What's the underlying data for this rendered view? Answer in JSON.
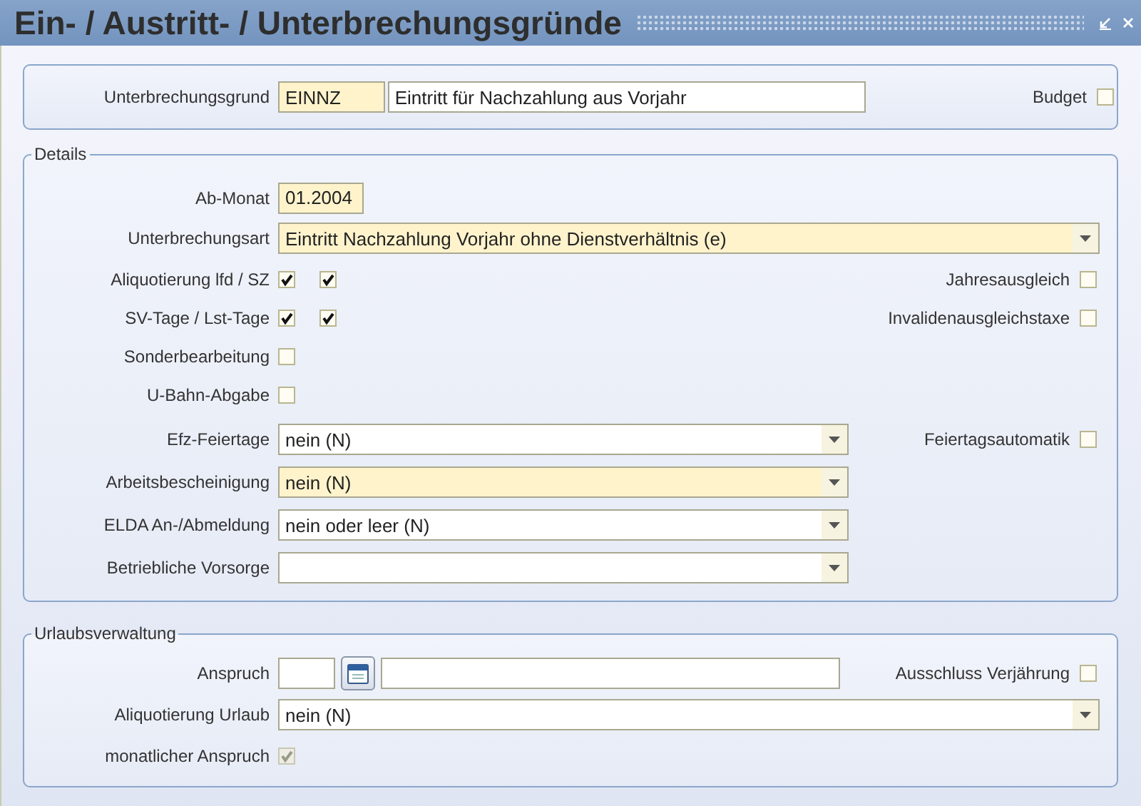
{
  "window": {
    "title": "Ein- / Austritt- / Unterbrechungsgründe"
  },
  "header": {
    "label": "Unterbrechungsgrund",
    "code": "EINNZ",
    "code_required": true,
    "description": "Eintritt für Nachzahlung aus Vorjahr",
    "side": {
      "label": "Budget",
      "checked": false,
      "disabled": false
    }
  },
  "details": {
    "title": "Details",
    "rows": [
      {
        "kind": "text",
        "label": "Ab-Monat",
        "value": "01.2004",
        "required": true
      },
      {
        "kind": "wide_select",
        "label": "Unterbrechungsart",
        "value": "Eintritt Nachzahlung Vorjahr ohne Dienstverhältnis (e)",
        "required": true
      },
      {
        "kind": "checks",
        "label": "Aliquotierung lfd / SZ",
        "checks": [
          {
            "checked": true,
            "disabled": false
          },
          {
            "checked": true,
            "disabled": false
          }
        ],
        "side": {
          "label": "Jahresausgleich",
          "checked": false,
          "disabled": false
        }
      },
      {
        "kind": "checks",
        "label": "SV-Tage / Lst-Tage",
        "checks": [
          {
            "checked": true,
            "disabled": false
          },
          {
            "checked": true,
            "disabled": false
          }
        ],
        "side": {
          "label": "Invalidenausgleichstaxe",
          "checked": false,
          "disabled": false
        }
      },
      {
        "kind": "checks",
        "label": "Sonderbearbeitung",
        "checks": [
          {
            "checked": false,
            "disabled": false
          }
        ]
      },
      {
        "kind": "checks",
        "label": "U-Bahn-Abgabe",
        "checks": [
          {
            "checked": false,
            "disabled": false
          }
        ]
      },
      {
        "kind": "select",
        "label": "Efz-Feiertage",
        "value": "nein (N)",
        "required": false,
        "side": {
          "label": "Feiertagsautomatik",
          "checked": false,
          "disabled": false
        }
      },
      {
        "kind": "select",
        "label": "Arbeitsbescheinigung",
        "value": "nein (N)",
        "required": true
      },
      {
        "kind": "select",
        "label": "ELDA An-/Abmeldung",
        "value": "nein oder leer (N)",
        "required": false
      },
      {
        "kind": "select",
        "label": "Betriebliche Vorsorge",
        "required": false
      }
    ]
  },
  "vacation": {
    "title": "Urlaubsverwaltung",
    "rows": [
      {
        "kind": "entitlement",
        "label": "Anspruch",
        "side": {
          "label": "Ausschluss Verjährung",
          "checked": false,
          "disabled": false
        }
      },
      {
        "kind": "wide_select",
        "label": "Aliquotierung Urlaub",
        "value": "nein (N)",
        "required": false
      },
      {
        "kind": "checks",
        "label": "monatlicher Anspruch",
        "checks": [
          {
            "checked": true,
            "disabled": true
          }
        ]
      }
    ]
  }
}
